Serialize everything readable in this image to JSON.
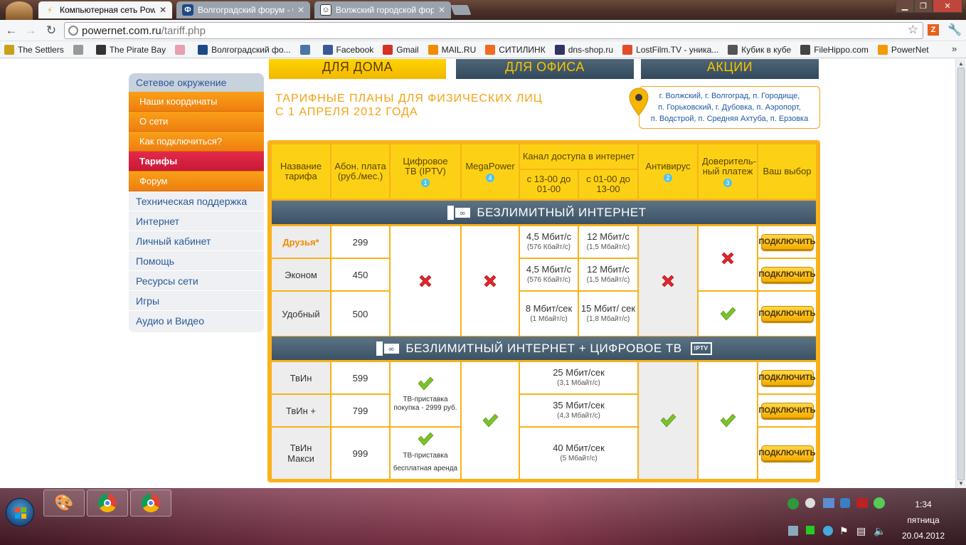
{
  "browser": {
    "tabs": [
      {
        "title": "Компьютерная сеть Power",
        "favicon": "powernet-bolt-icon",
        "active": true
      },
      {
        "title": "Волгоградский форум - О",
        "favicon": "forum-f-icon",
        "active": false
      },
      {
        "title": "Волжский городской фор",
        "favicon": "forum-smiley-icon",
        "active": false
      }
    ],
    "url_host": "powernet.com.ru",
    "url_path": "/tariff.php",
    "bookmarks": [
      {
        "label": "The Settlers",
        "icon": "settlers-icon",
        "color": "#c9a21b"
      },
      {
        "label": "",
        "icon": "colored-bug-icon",
        "color": "#999999"
      },
      {
        "label": "The Pirate Bay",
        "icon": "pirate-ship-icon",
        "color": "#333333"
      },
      {
        "label": "",
        "icon": "pig-icon",
        "color": "#e7a0b0"
      },
      {
        "label": "Волгоградский фо...",
        "icon": "forum-f-icon",
        "color": "#1d4a87"
      },
      {
        "label": "",
        "icon": "vk-icon",
        "color": "#4a76a8"
      },
      {
        "label": "Facebook",
        "icon": "facebook-icon",
        "color": "#3b5998"
      },
      {
        "label": "Gmail",
        "icon": "gmail-icon",
        "color": "#d93025"
      },
      {
        "label": "MAIL.RU",
        "icon": "mailru-icon",
        "color": "#f08c00"
      },
      {
        "label": "СИТИЛИНК",
        "icon": "citilink-icon",
        "color": "#f26a21"
      },
      {
        "label": "dns-shop.ru",
        "icon": "dns-icon",
        "color": "#333366"
      },
      {
        "label": "LostFilm.TV - уника...",
        "icon": "lostfilm-icon",
        "color": "#e24c2a"
      },
      {
        "label": "Кубик в кубе",
        "icon": "person-icon",
        "color": "#555555"
      },
      {
        "label": "FileHippo.com",
        "icon": "filehippo-icon",
        "color": "#444444"
      },
      {
        "label": "PowerNet",
        "icon": "powernet-bolt-icon",
        "color": "#f29a00"
      }
    ]
  },
  "top_tabs": [
    "ДЛЯ ДОМА",
    "ДЛЯ ОФИСА",
    "АКЦИИ"
  ],
  "sidebar": {
    "head": "Сетевое окружение",
    "sub": [
      "Наши координаты",
      "О сети",
      "Как подключиться?",
      "Тарифы",
      "Форум"
    ],
    "items": [
      "Техническая поддержка",
      "Интернет",
      "Личный кабинет",
      "Помощь",
      "Ресурсы сети",
      "Игры",
      "Аудио и Видео"
    ]
  },
  "heading": {
    "line1": "ТАРИФНЫЕ ПЛАНЫ ДЛЯ ФИЗИЧЕСКИХ ЛИЦ",
    "line2": "С 1 АПРЕЛЯ 2012 ГОДА"
  },
  "locations": {
    "line1": "г. Волжский, г. Волгоград, п. Городище,",
    "line2": "п. Горьковский, г. Дубовка, п. Аэропорт,",
    "line3": "п. Водстрой, п. Средняя Ахтуба, п. Ерзовка"
  },
  "table": {
    "headers": {
      "name": "Название тарифа",
      "fee": "Абон. плата (руб./мес.)",
      "tv": "Цифровое ТВ (IPTV)",
      "tv_note": "1",
      "mega": "MegaPower",
      "mega_note": "4",
      "channel": "Канал доступа в интернет",
      "day": "с 13-00 до 01-00",
      "night": "с 01-00 до 13-00",
      "av": "Антивирус",
      "av_note": "2",
      "trust": "Доверитель-ный платеж",
      "trust_note": "3",
      "choice": "Ваш выбор"
    },
    "band1": "БЕЗЛИМИТНЫЙ ИНТЕРНЕТ",
    "band2": "БЕЗЛИМИТНЫЙ ИНТЕРНЕТ + ЦИФРОВОЕ ТВ",
    "band2_badge": "IPTV",
    "button_label": "ПОДКЛЮЧИТЬ",
    "internet_rows": [
      {
        "name": "Друзья*",
        "fee": "299",
        "day": "4,5 Мбит/с",
        "day_sub": "(576 Кбайт/с)",
        "night": "12 Мбит/с",
        "night_sub": "(1,5 Мбайт/с)"
      },
      {
        "name": "Эконом",
        "fee": "450",
        "day": "4,5 Мбит/с",
        "day_sub": "(576 Кбайт/с)",
        "night": "12 Мбит/с",
        "night_sub": "(1,5 Мбайт/с)"
      },
      {
        "name": "Удобный",
        "fee": "500",
        "day": "8 Мбит/сек",
        "day_sub": "(1 Мбайт/с)",
        "night": "15 Мбит/ сек",
        "night_sub": "(1,8 Мбайт/с)"
      }
    ],
    "tv_rows": [
      {
        "name": "ТвИн",
        "fee": "599",
        "speed": "25 Мбит/сек",
        "speed_sub": "(3,1 Мбайт/с)"
      },
      {
        "name": "ТвИн +",
        "fee": "799",
        "speed": "35 Мбит/сек",
        "speed_sub": "(4,3 Мбайт/с)"
      },
      {
        "name": "ТвИн Макси",
        "fee": "999",
        "speed": "40 Мбит/сек",
        "speed_sub": "(5 Мбайт/с)"
      }
    ],
    "tv_box_buy": "ТВ-приставка покупка - 2999 руб.",
    "tv_box_rent": "ТВ-приставка бесплатная аренда"
  },
  "taskbar": {
    "time": "1:34",
    "day": "пятница",
    "date": "20.04.2012",
    "apps": [
      "paint-icon",
      "chrome-icon",
      "chrome-icon"
    ]
  }
}
